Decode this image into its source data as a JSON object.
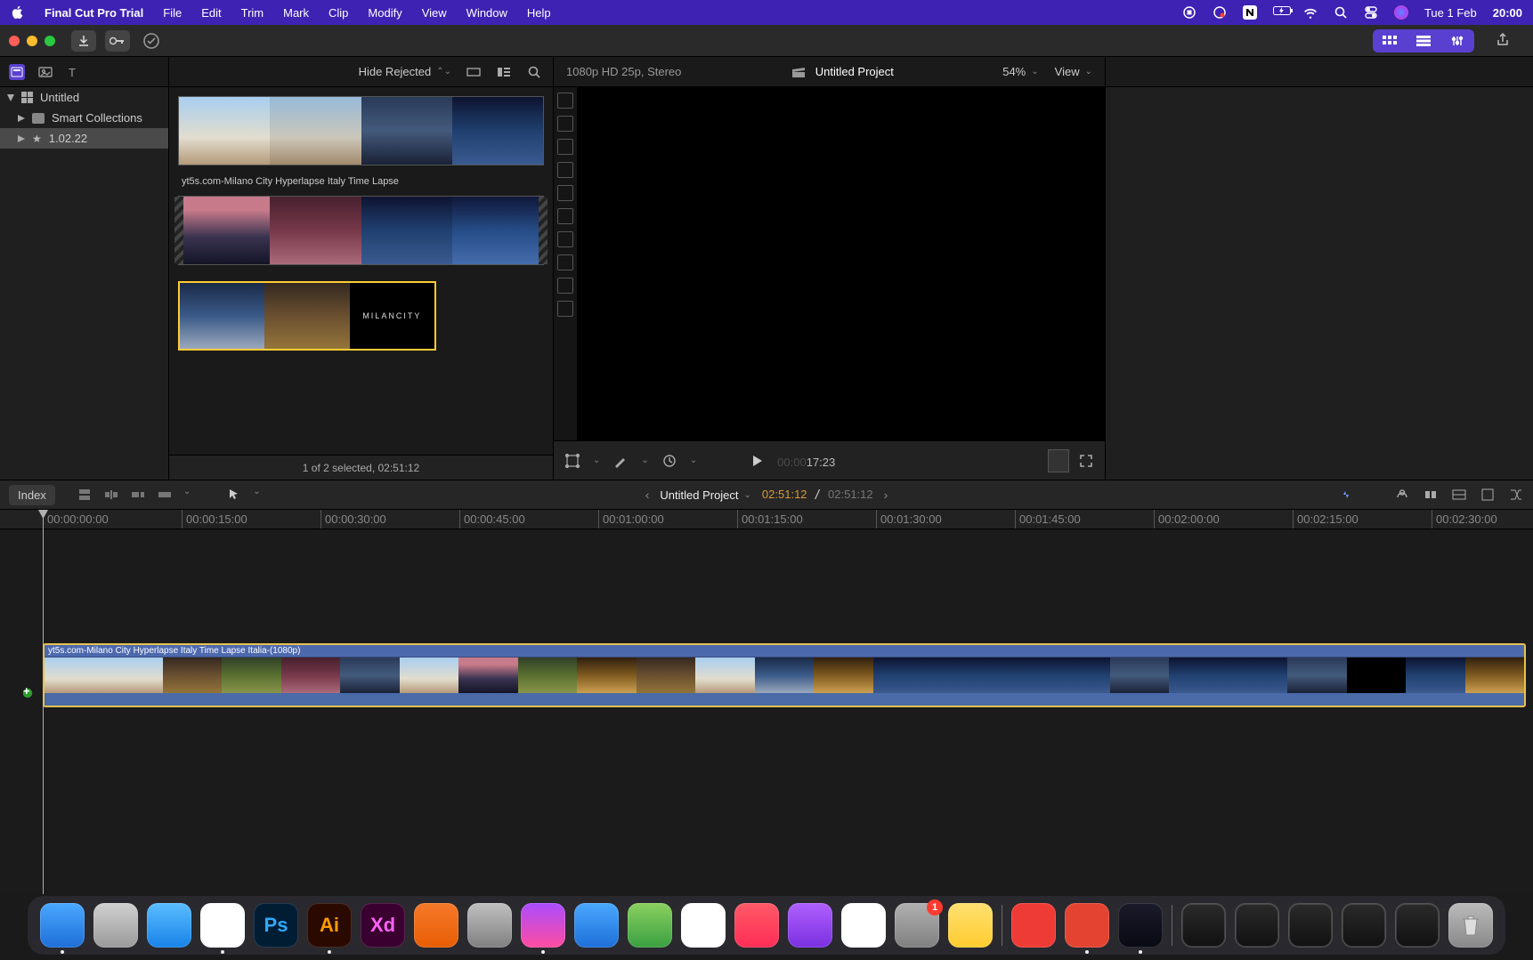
{
  "menubar": {
    "app_name": "Final Cut Pro Trial",
    "items": [
      "File",
      "Edit",
      "Trim",
      "Mark",
      "Clip",
      "Modify",
      "View",
      "Window",
      "Help"
    ],
    "status": {
      "date": "Tue 1 Feb",
      "time": "20:00"
    }
  },
  "toolbar": {
    "import_icon": "import-icon",
    "keyword_icon": "key-icon",
    "bg_icon": "checkmark-circle-icon"
  },
  "browser_bar": {
    "library_icons": [
      "library-icon",
      "photos-video-icon",
      "titles-icon"
    ],
    "filter_label": "Hide Rejected",
    "view_icons": [
      "clip-list-icon",
      "filmstrip-icon",
      "search-icon"
    ]
  },
  "viewer_bar": {
    "format": "1080p HD 25p, Stereo",
    "project": "Untitled Project",
    "zoom": "54%",
    "view_label": "View"
  },
  "sidebar": {
    "items": [
      {
        "label": "Untitled",
        "kind": "library"
      },
      {
        "label": "Smart Collections",
        "kind": "folder"
      },
      {
        "label": "1.02.22",
        "kind": "event"
      }
    ]
  },
  "browser": {
    "clip1_name": "yt5s.com-Milano City Hyperlapse Italy Time Lapse",
    "clip3_title": "MILANCITY",
    "status": "1 of 2 selected, 02:51:12"
  },
  "viewer_toolbar": {
    "tc_ghost": "00:00",
    "tc": "17:23"
  },
  "timeline_header": {
    "index_label": "Index",
    "project": "Untitled Project",
    "tc_current": "02:51:12",
    "tc_total": "02:51:12"
  },
  "ruler_ticks": [
    "00:00:00:00",
    "00:00:15:00",
    "00:00:30:00",
    "00:00:45:00",
    "00:01:00:00",
    "00:01:15:00",
    "00:01:30:00",
    "00:01:45:00",
    "00:02:00:00",
    "00:02:15:00",
    "00:02:30:00"
  ],
  "timeline": {
    "clip_label": "yt5s.com-Milano City Hyperlapse Italy Time Lapse Italia-(1080p)"
  },
  "dock": {
    "apps": [
      {
        "name": "finder",
        "bg": "linear-gradient(#4aa8ff,#1e6fd8)",
        "glyph": "",
        "running": true
      },
      {
        "name": "launchpad",
        "bg": "linear-gradient(#d0d0d0,#9a9a9a)",
        "glyph": "",
        "running": false
      },
      {
        "name": "safari",
        "bg": "linear-gradient(#5abeff,#1882e8)",
        "glyph": "",
        "running": false
      },
      {
        "name": "chrome",
        "bg": "#fff",
        "glyph": "",
        "running": true
      },
      {
        "name": "photoshop",
        "bg": "#001d34",
        "glyph": "Ps",
        "color": "#31a8ff",
        "running": false
      },
      {
        "name": "illustrator",
        "bg": "#2a0a00",
        "glyph": "Ai",
        "color": "#ff9a00",
        "running": true
      },
      {
        "name": "xd",
        "bg": "#3a0030",
        "glyph": "Xd",
        "color": "#ff61f6",
        "running": false
      },
      {
        "name": "blender",
        "bg": "linear-gradient(#f5792a,#e85d04)",
        "glyph": "",
        "running": false
      },
      {
        "name": "krita",
        "bg": "linear-gradient(#c0c0c0,#808080)",
        "glyph": "",
        "running": false
      },
      {
        "name": "messenger",
        "bg": "linear-gradient(#aa4cff,#ff4ca0)",
        "glyph": "",
        "running": true
      },
      {
        "name": "mail",
        "bg": "linear-gradient(#4aa8ff,#1e6fd8)",
        "glyph": "",
        "running": false
      },
      {
        "name": "maps",
        "bg": "linear-gradient(#8ad060,#3aa040)",
        "glyph": "",
        "running": false
      },
      {
        "name": "photos",
        "bg": "#fff",
        "glyph": "",
        "running": false
      },
      {
        "name": "music",
        "bg": "linear-gradient(#ff5a68,#ff2d55)",
        "glyph": "",
        "running": false
      },
      {
        "name": "podcasts",
        "bg": "linear-gradient(#b060ff,#7a30e0)",
        "glyph": "",
        "running": false
      },
      {
        "name": "numbers",
        "bg": "#fff",
        "glyph": "",
        "running": false
      },
      {
        "name": "settings",
        "bg": "linear-gradient(#b0b0b0,#808080)",
        "glyph": "",
        "running": false,
        "badge": "1"
      },
      {
        "name": "notes",
        "bg": "linear-gradient(#ffe070,#ffcc30)",
        "glyph": "",
        "running": false
      }
    ],
    "apps2": [
      {
        "name": "anydesk",
        "bg": "#ef3b36",
        "glyph": "",
        "running": false
      },
      {
        "name": "todoist",
        "bg": "#e44332",
        "glyph": "",
        "running": true
      },
      {
        "name": "finalcutpro",
        "bg": "linear-gradient(#1a1a2a,#0a0a14)",
        "glyph": "",
        "running": true
      }
    ],
    "minis": 5
  }
}
